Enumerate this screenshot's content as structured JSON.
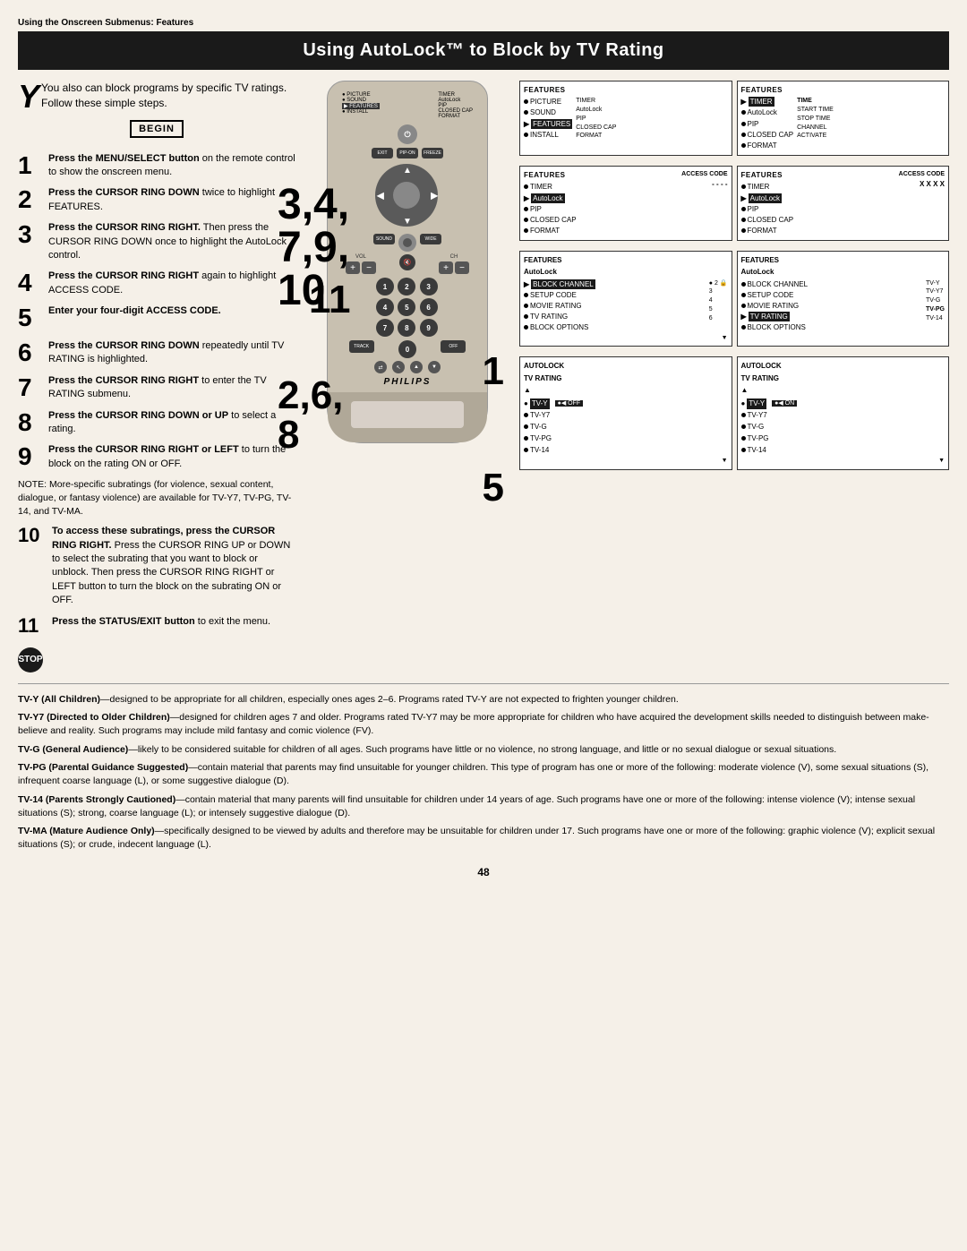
{
  "page": {
    "section_label": "Using the Onscreen Submenus: Features",
    "title": "Using AutoLock™ to Block by TV Rating",
    "page_number": "48"
  },
  "intro": {
    "text": "You also can block programs by specific TV ratings. Follow these simple steps."
  },
  "begin_label": "BEGIN",
  "steps": [
    {
      "number": "1",
      "bold_text": "Press the MENU/SELECT button",
      "rest_text": " on the remote control to show the onscreen menu."
    },
    {
      "number": "2",
      "bold_text": "Press the CURSOR RING DOWN",
      "rest_text": " twice to highlight FEATURES."
    },
    {
      "number": "3",
      "bold_text": "Press the CURSOR RING RIGHT.",
      "rest_text": " Then press the CURSOR RING DOWN once to highlight the AutoLock control."
    },
    {
      "number": "4",
      "bold_text": "Press the CURSOR RING RIGHT",
      "rest_text": " again to highlight ACCESS CODE."
    },
    {
      "number": "5",
      "bold_text": "Enter your four-digit ACCESS CODE."
    },
    {
      "number": "6",
      "bold_text": "Press the CURSOR RING DOWN",
      "rest_text": " repeatedly until TV RATING is highlighted."
    },
    {
      "number": "7",
      "bold_text": "Press the CURSOR RING RIGHT",
      "rest_text": " to enter the TV RATING submenu."
    },
    {
      "number": "8",
      "bold_text": "Press the CURSOR RING DOWN or UP",
      "rest_text": " to select a rating."
    },
    {
      "number": "9",
      "bold_text": "Press the CURSOR RING RIGHT or LEFT",
      "rest_text": " to turn the block on the rating ON or OFF."
    }
  ],
  "note_text": "NOTE: More-specific subratings (for violence, sexual content, dialogue, or fantasy violence) are available for TV-Y7, TV-PG, TV-14, and TV-MA.",
  "step_10": {
    "number": "10",
    "bold_text": "To access these subratings, press the CURSOR RING RIGHT.",
    "rest_text": " Press the CURSOR RING UP or DOWN to select the subrating that you want to block or unblock. Then press the CURSOR RING RIGHT or LEFT button to turn the block on the subrating ON or OFF."
  },
  "step_11": {
    "number": "11",
    "bold_text": "Press the STATUS/EXIT button",
    "rest_text": " to exit the menu."
  },
  "stop_label": "STOP",
  "panels": {
    "top_left": {
      "title": "FEATURES",
      "items": [
        "PICTURE",
        "SOUND",
        "FEATURES",
        "INSTALL"
      ],
      "right_items": [
        "TIMER",
        "AutoLock",
        "PIP",
        "CLOSED CAP",
        "FORMAT"
      ],
      "highlighted": "FEATURES"
    },
    "top_right": {
      "title": "FEATURES",
      "items_left": [
        "TIMER",
        "AutoLock",
        "PIP",
        "CLOSED CAP",
        "FORMAT"
      ],
      "items_right": [
        "TIME",
        "START TIME",
        "STOP TIME",
        "CHANNEL",
        "ACTIVATE"
      ],
      "highlighted": "TIMER"
    },
    "mid_left_1": {
      "title": "FEATURES",
      "items": [
        "TIMER",
        "AutoLock",
        "PIP",
        "CLOSED CAP",
        "FORMAT"
      ],
      "access_code": "- - - -"
    },
    "mid_right_1": {
      "title": "FEATURES",
      "items": [
        "TIMER",
        "AutoLock",
        "PIP",
        "CLOSED CAP",
        "FORMAT"
      ],
      "access_code": "X X X X"
    },
    "mid_left_2": {
      "title": "FEATURES",
      "subtitle": "AutoLock",
      "items": [
        "BLOCK CHANNEL",
        "SETUP CODE",
        "MOVIE RATING",
        "TV RATING",
        "BLOCK OPTIONS"
      ],
      "nums": [
        "2",
        "3",
        "4",
        "5",
        "6"
      ],
      "highlighted": "BLOCK CHANNEL"
    },
    "mid_right_2": {
      "title": "FEATURES",
      "subtitle": "AutoLock",
      "items": [
        "BLOCK CHANNEL",
        "SETUP CODE",
        "MOVIE RATING",
        "TV RATING",
        "BLOCK OPTIONS"
      ],
      "right_vals": [
        "TV-Y",
        "TV-Y7",
        "TV-G",
        "TV-PG",
        "TV-14"
      ],
      "highlighted": "TV RATING"
    },
    "bot_left": {
      "title": "AutoLock",
      "subtitle": "TV RATING",
      "items": [
        "TV-Y",
        "TV-Y7",
        "TV-G",
        "TV-PG",
        "TV-14"
      ],
      "highlighted": "TV-Y",
      "status": "OFF"
    },
    "bot_right": {
      "title": "AutoLock",
      "subtitle": "TV RATING",
      "items": [
        "TV-Y",
        "TV-Y7",
        "TV-G",
        "TV-PG",
        "TV-14"
      ],
      "highlighted": "TV-Y",
      "status": "ON"
    }
  },
  "bottom_descriptions": [
    {
      "term": "TV-Y (All Children)",
      "definition": "—designed to be appropriate for all children, especially ones ages 2–6. Programs rated TV-Y are not expected to frighten younger children."
    },
    {
      "term": "TV-Y7 (Directed to Older Children)",
      "definition": "—designed for children ages 7 and older. Programs rated TV-Y7 may be more appropriate for children who have acquired the development skills needed to distinguish between make-believe and reality. Such programs may include mild fantasy and comic violence (FV)."
    },
    {
      "term": "TV-G (General Audience)",
      "definition": "—likely to be considered suitable for children of all ages. Such programs have little or no violence, no strong language, and little or no sexual dialogue or sexual situations."
    },
    {
      "term": "TV-PG (Parental Guidance Suggested)",
      "definition": "—contain material that parents may find unsuitable for younger children. This type of program has one or more of the following: moderate violence (V), some sexual situations (S), infrequent coarse language (L), or some suggestive dialogue (D)."
    },
    {
      "term": "TV-14 (Parents Strongly Cautioned)",
      "definition": "—contain material that many parents will find unsuitable for children under 14 years of age. Such programs have one or more of the following: intense violence (V); intense sexual situations (S); strong, coarse language (L); or intensely suggestive dialogue (D)."
    },
    {
      "term": "TV-MA (Mature Audience Only)",
      "definition": "—specifically designed to be viewed by adults and therefore may be unsuitable for children under 17. Such programs have one or more of the following: graphic violence (V); explicit sexual situations (S); or crude, indecent language (L)."
    }
  ]
}
